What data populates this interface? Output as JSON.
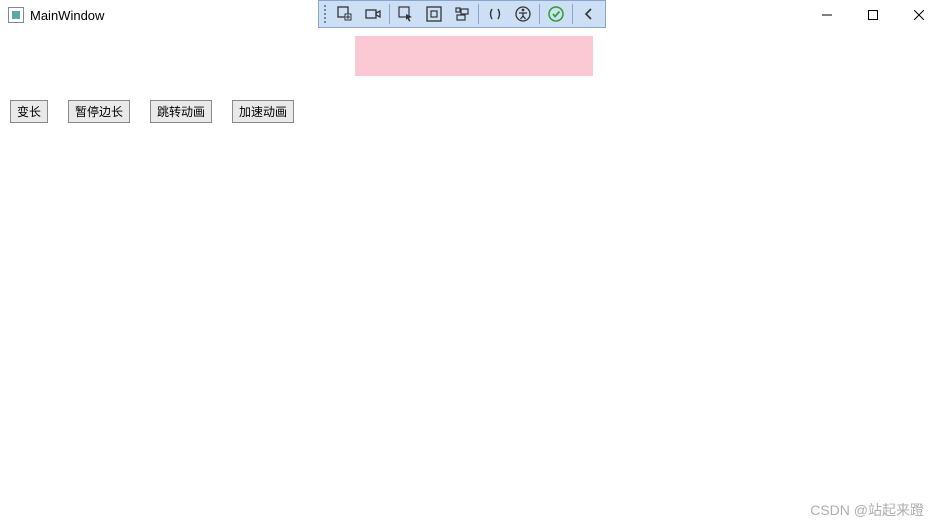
{
  "window": {
    "title": "MainWindow"
  },
  "toolbar": {
    "icons": [
      "live-visual-tree",
      "camera",
      "select-element",
      "layout-adorners",
      "track-focused",
      "xaml-binding",
      "accessibility",
      "hot-reload",
      "collapse-left"
    ]
  },
  "content": {
    "pink_box_color": "#fbc9d4"
  },
  "buttons": {
    "grow": "变长",
    "pause": "暂停边长",
    "jump": "跳转动画",
    "accel": "加速动画"
  },
  "watermark": "CSDN @站起来蹬"
}
